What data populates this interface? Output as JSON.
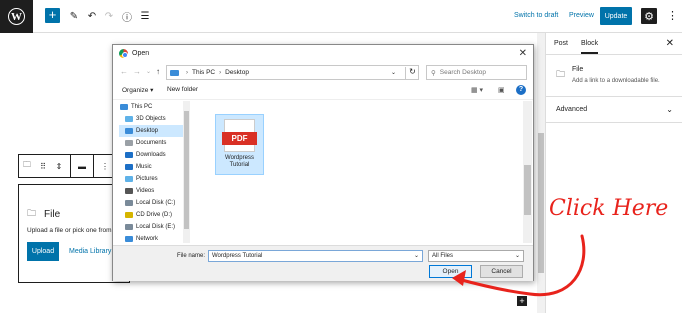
{
  "wp": {
    "toolbar": {
      "switch_to_draft": "Switch to draft",
      "preview": "Preview",
      "update": "Update"
    },
    "sidebar": {
      "tab_post": "Post",
      "tab_block": "Block",
      "block_name": "File",
      "block_desc": "Add a link to a downloadable file.",
      "advanced": "Advanced"
    },
    "file_block": {
      "title": "File",
      "description": "Upload a file or pick one from",
      "upload_label": "Upload",
      "media_library_label": "Media Library"
    }
  },
  "dialog": {
    "title": "Open",
    "breadcrumb": [
      "This PC",
      "Desktop"
    ],
    "search_placeholder": "Search Desktop",
    "organize_label": "Organize ▾",
    "new_folder_label": "New folder",
    "nav_items": [
      {
        "label": "This PC",
        "icon": "pc-icon",
        "color": "#3a8cd8"
      },
      {
        "label": "3D Objects",
        "icon": "3d-objects-icon",
        "color": "#5fb2e8"
      },
      {
        "label": "Desktop",
        "icon": "desktop-icon",
        "color": "#3a8cd8",
        "selected": true
      },
      {
        "label": "Documents",
        "icon": "documents-icon",
        "color": "#9aa0a6"
      },
      {
        "label": "Downloads",
        "icon": "downloads-icon",
        "color": "#1c6fc6"
      },
      {
        "label": "Music",
        "icon": "music-icon",
        "color": "#1c6fc6"
      },
      {
        "label": "Pictures",
        "icon": "pictures-icon",
        "color": "#5fb2e8"
      },
      {
        "label": "Videos",
        "icon": "videos-icon",
        "color": "#555555"
      },
      {
        "label": "Local Disk (C:)",
        "icon": "disk-icon",
        "color": "#7a8a99"
      },
      {
        "label": "CD Drive (D:)",
        "icon": "cd-drive-icon",
        "color": "#d6b500"
      },
      {
        "label": "Local Disk (E:)",
        "icon": "disk-icon",
        "color": "#7a8a99"
      },
      {
        "label": "Network",
        "icon": "network-icon",
        "color": "#3a8cd8"
      }
    ],
    "file_item": {
      "badge": "PDF",
      "name": "Wordpress Tutorial"
    },
    "file_name_label": "File name:",
    "file_name_value": "Wordpress Tutorial",
    "filter_value": "All Files",
    "open_label": "Open",
    "cancel_label": "Cancel"
  },
  "annotation": {
    "text": "Click Here",
    "color": "#e8231c"
  },
  "colors": {
    "wp_blue": "#0073aa",
    "wp_dark": "#1e1e1e",
    "selection": "#cce8ff"
  }
}
